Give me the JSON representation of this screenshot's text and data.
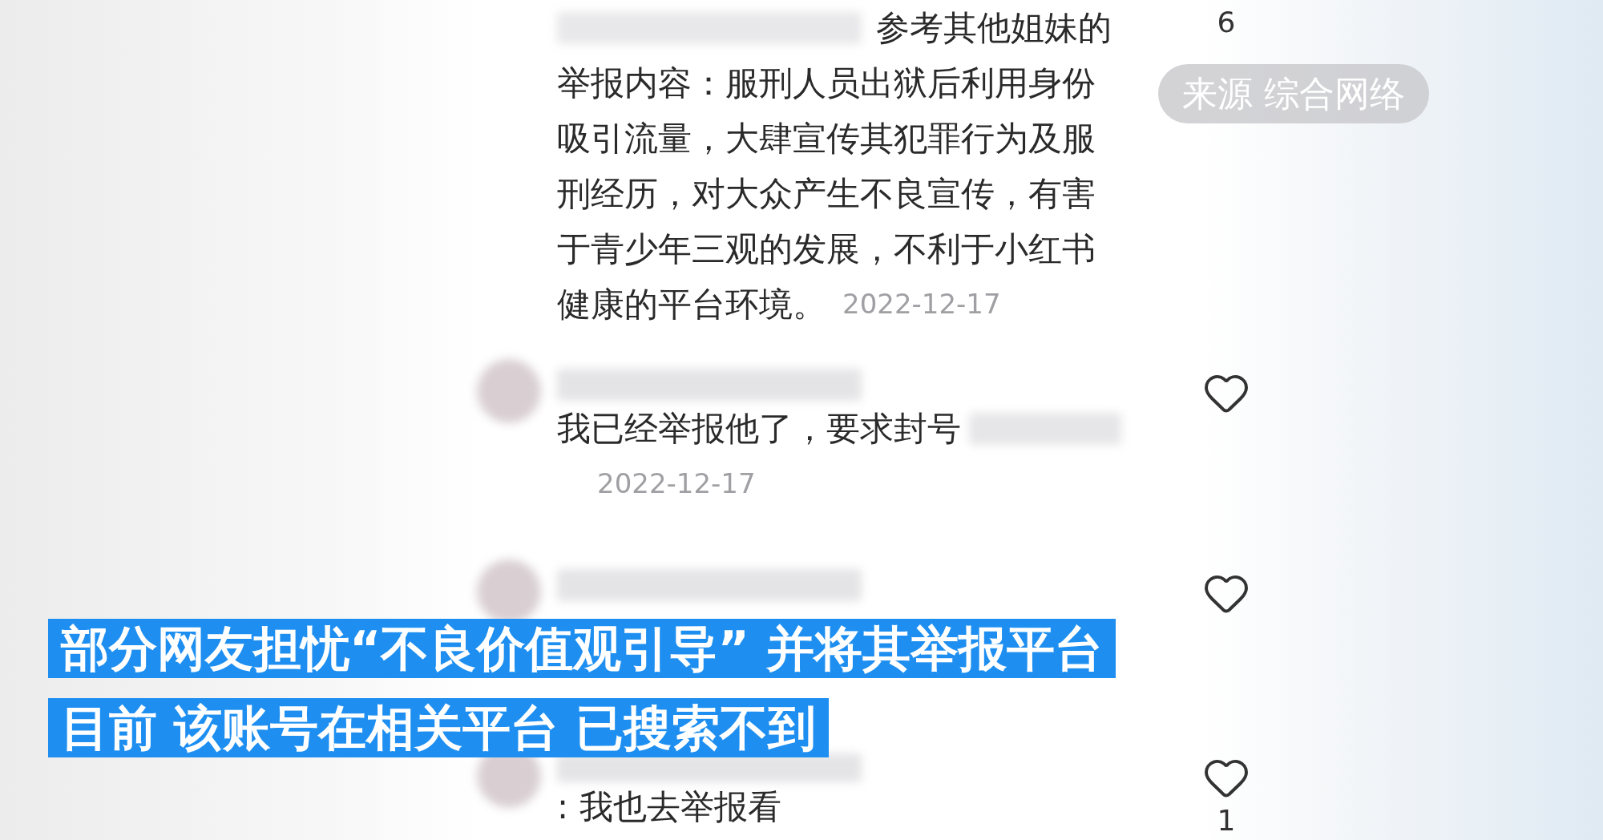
{
  "comments": [
    {
      "lines": [
        "参考其他姐妹的",
        "举报内容：服刑人员出狱后利用身份",
        "吸引流量，大肆宣传其犯罪行为及服",
        "刑经历，对大众产生不良宣传，有害",
        "于青少年三观的发展，不利于小红书",
        "健康的平台环境。"
      ],
      "date": "2022-12-17",
      "avatar": false,
      "heart": false,
      "count": "6"
    },
    {
      "lines": [
        "我已经举报他了，要求封号"
      ],
      "date": "2022-12-17",
      "avatar": true,
      "heart": true
    },
    {
      "avatar": true,
      "heart": true
    },
    {
      "lines": [
        ": 我也去举报看"
      ],
      "avatar": true,
      "heart": true,
      "count": "1"
    }
  ],
  "source_label": "来源 综合网络",
  "captions": [
    "部分网友担忧“不良价值观引导” 并将其举报平台",
    "目前 该账号在相关平台 已搜索不到"
  ]
}
